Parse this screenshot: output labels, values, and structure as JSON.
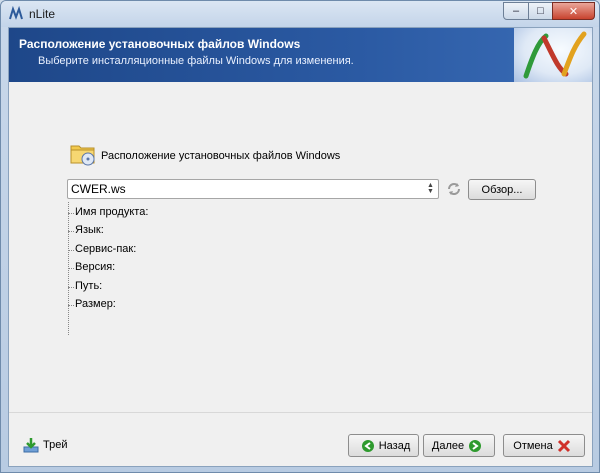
{
  "window": {
    "title": "nLite",
    "controls": {
      "minimize": "–",
      "maximize": "□",
      "close": "✕"
    }
  },
  "header": {
    "title": "Расположение установочных файлов Windows",
    "subtitle": "Выберите инсталляционные файлы Windows для изменения."
  },
  "source": {
    "section_label": "Расположение установочных файлов Windows",
    "combo_value": "CWER.ws",
    "browse_label": "Обзор...",
    "info_items": [
      {
        "label": "Имя продукта:"
      },
      {
        "label": "Язык:"
      },
      {
        "label": "Сервис-пак:"
      },
      {
        "label": "Версия:"
      },
      {
        "label": "Путь:"
      },
      {
        "label": "Размер:"
      }
    ]
  },
  "footer": {
    "tray_label": "Трей",
    "back_label": "Назад",
    "next_label": "Далее",
    "cancel_label": "Отмена"
  },
  "colors": {
    "header_bg": "#1e4789",
    "accent_green": "#2e9a2e",
    "cancel_red": "#d0302a"
  }
}
